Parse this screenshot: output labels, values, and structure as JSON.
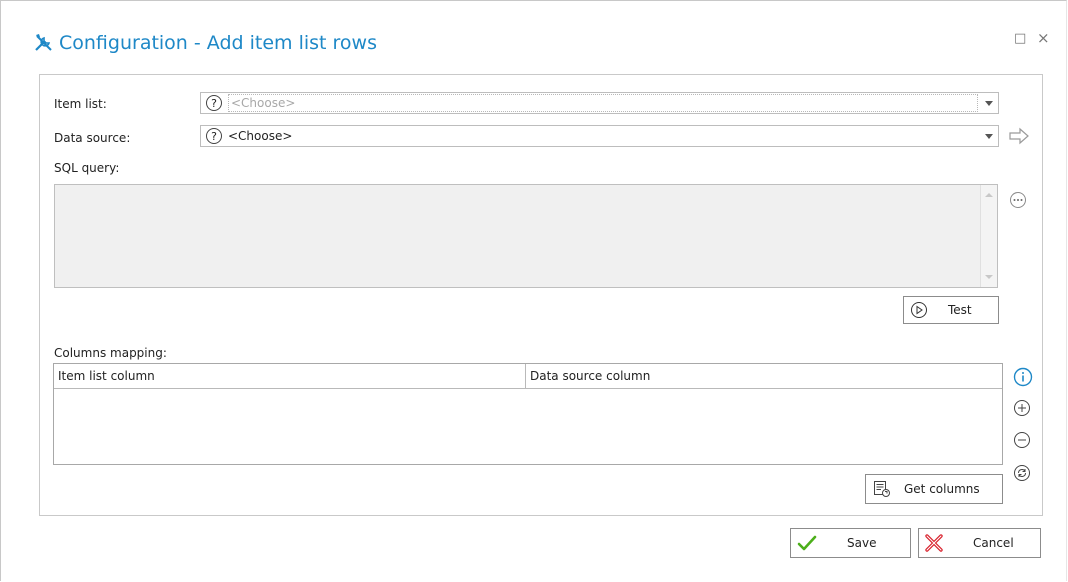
{
  "window": {
    "title": "Configuration - Add item list rows",
    "maximize_glyph": "□",
    "close_glyph": "×"
  },
  "form": {
    "item_list": {
      "label": "Item list:",
      "value": "<Choose>"
    },
    "data_source": {
      "label": "Data source:",
      "value": "<Choose>"
    },
    "sql_query": {
      "label": "SQL query:"
    },
    "test_button": "Test",
    "columns_mapping": {
      "label": "Columns mapping:",
      "columns": [
        "Item list column",
        "Data source column"
      ],
      "rows": []
    },
    "get_columns_button": "Get columns"
  },
  "footer": {
    "save_label": "Save",
    "cancel_label": "Cancel"
  },
  "colors": {
    "accent": "#1e88c7",
    "save_check": "#4caf1a",
    "cancel_x": "#d9232e"
  }
}
